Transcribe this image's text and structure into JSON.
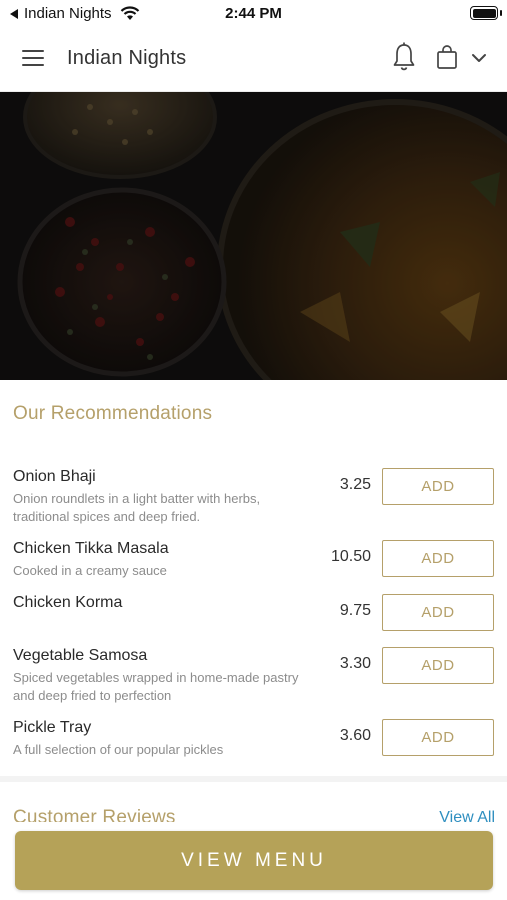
{
  "status_bar": {
    "back_app": "Indian Nights",
    "time": "2:44 PM"
  },
  "header": {
    "title": "Indian Nights",
    "icons": [
      "menu-icon",
      "bell-icon",
      "shopping-bag-icon",
      "chevron-down-icon"
    ]
  },
  "recommendations": {
    "title": "Our Recommendations",
    "items": [
      {
        "name": "Onion Bhaji",
        "description": "Onion roundlets in a light batter with herbs, traditional spices and deep fried.",
        "price": "3.25",
        "add_label": "ADD"
      },
      {
        "name": "Chicken Tikka Masala",
        "description": "Cooked in a creamy sauce",
        "price": "10.50",
        "add_label": "ADD"
      },
      {
        "name": "Chicken Korma",
        "description": "",
        "price": "9.75",
        "add_label": "ADD"
      },
      {
        "name": "Vegetable Samosa",
        "description": "Spiced vegetables wrapped in home-made pastry and deep fried to perfection",
        "price": "3.30",
        "add_label": "ADD"
      },
      {
        "name": "Pickle Tray",
        "description": "A full selection of our popular pickles",
        "price": "3.60",
        "add_label": "ADD"
      }
    ]
  },
  "reviews": {
    "title": "Customer Reviews",
    "view_all": "View All"
  },
  "footer": {
    "view_menu_label": "VIEW MENU"
  },
  "colors": {
    "accent_gold": "#b5a06a",
    "button_gold": "#b5a258",
    "link_blue": "#2f8fc0"
  }
}
